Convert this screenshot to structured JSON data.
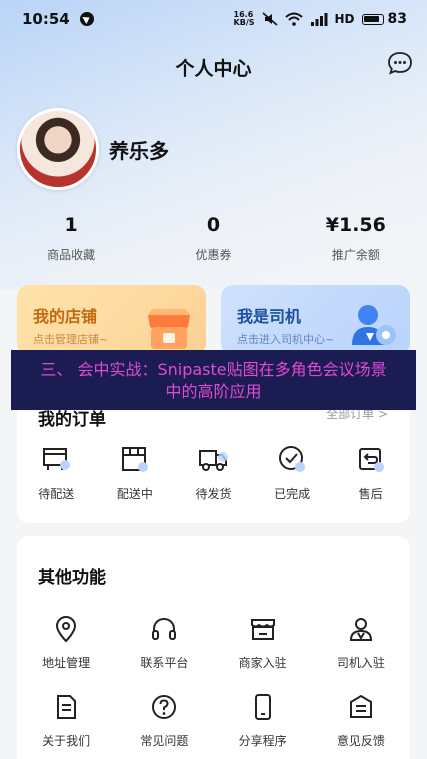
{
  "status_bar": {
    "time": "10:54",
    "net_speed_top": "16.6",
    "net_speed_bottom": "KB/S",
    "network": "HD",
    "battery": "83"
  },
  "header": {
    "title": "个人中心",
    "message_icon": "chat-bubble-icon"
  },
  "profile": {
    "username": "养乐多"
  },
  "stats": [
    {
      "value": "1",
      "label": "商品收藏"
    },
    {
      "value": "0",
      "label": "优惠券"
    },
    {
      "value": "¥1.56",
      "label": "推广余额"
    }
  ],
  "cards": {
    "shop": {
      "title": "我的店铺",
      "subtitle": "点击管理店铺~",
      "icon": "storefront-icon"
    },
    "driver": {
      "title": "我是司机",
      "subtitle": "点击进入司机中心~",
      "icon": "driver-badge-icon"
    }
  },
  "banner": {
    "line1": "三、 会中实战：Snipaste贴图在多角色会议场景",
    "line2": "中的高阶应用"
  },
  "orders": {
    "title": "我的订单",
    "all_label": "全部订单 >",
    "items": [
      {
        "label": "待配送",
        "icon": "pending-delivery-icon"
      },
      {
        "label": "配送中",
        "icon": "in-delivery-icon"
      },
      {
        "label": "待发货",
        "icon": "truck-icon"
      },
      {
        "label": "已完成",
        "icon": "check-circle-icon"
      },
      {
        "label": "售后",
        "icon": "after-sales-icon"
      }
    ]
  },
  "other": {
    "title": "其他功能",
    "items": [
      {
        "label": "地址管理",
        "icon": "location-pin-icon"
      },
      {
        "label": "联系平台",
        "icon": "headset-icon"
      },
      {
        "label": "商家入驻",
        "icon": "shop-icon"
      },
      {
        "label": "司机入驻",
        "icon": "driver-icon"
      },
      {
        "label": "关于我们",
        "icon": "document-icon"
      },
      {
        "label": "常见问题",
        "icon": "question-icon"
      },
      {
        "label": "分享程序",
        "icon": "phone-icon"
      },
      {
        "label": "意见反馈",
        "icon": "feedback-icon"
      }
    ]
  },
  "colors": {
    "accent_blue": "#4a86e0",
    "shop_orange": "#c36a11",
    "banner_bg": "#1a1c52",
    "banner_text": "#e04ad6"
  }
}
